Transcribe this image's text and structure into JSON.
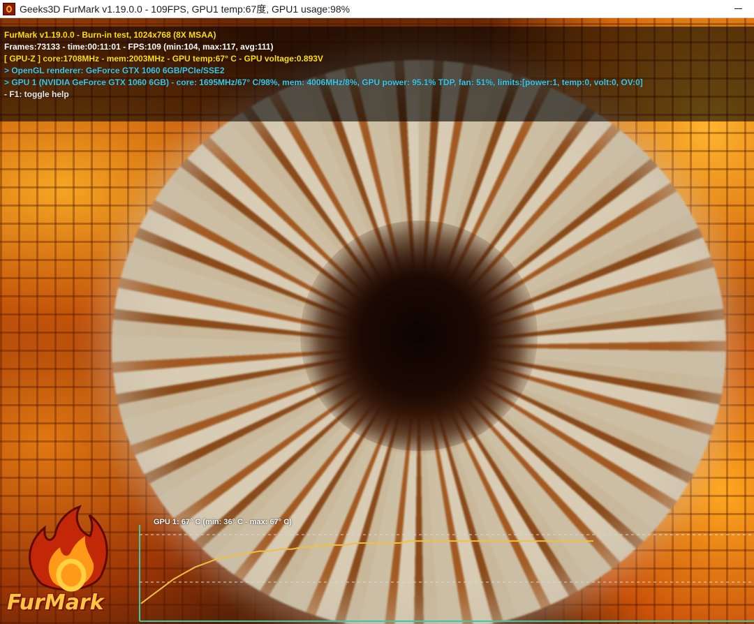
{
  "window": {
    "title": "Geeks3D FurMark v1.19.0.0 - 109FPS, GPU1 temp:67度, GPU1 usage:98%"
  },
  "icons": {
    "app": "furmark-app-icon",
    "minimize": "minimize-icon"
  },
  "hud": {
    "lines": [
      {
        "text": "FurMark v1.19.0.0 - Burn-in test, 1024x768 (8X MSAA)",
        "color": "#ffe000"
      },
      {
        "text": "Frames:73133 - time:00:11:01 - FPS:109 (min:104, max:117, avg:111)",
        "color": "#ffffff"
      },
      {
        "text": "[ GPU-Z ] core:1708MHz - mem:2003MHz - GPU temp:67° C - GPU voltage:0.893V",
        "color": "#ffe000"
      },
      {
        "text": "> OpenGL renderer: GeForce GTX 1060 6GB/PCIe/SSE2",
        "color": "#3ec8e8"
      },
      {
        "text": "> GPU 1 (NVIDIA GeForce GTX 1060 6GB) - core: 1695MHz/67° C/98%, mem: 4006MHz/8%, GPU power: 95.1% TDP, fan: 51%, limits:[power:1, temp:0, volt:0, OV:0]",
        "color": "#3ec8e8"
      },
      {
        "text": "- F1: toggle help",
        "color": "#e8e8e8"
      }
    ]
  },
  "graph": {
    "label": "GPU 1: 67° C (min: 36° C - max: 67° C)",
    "line_color": "#f0c040",
    "axis_color": "#3ec8a8",
    "grid_color": "#d8d8d8",
    "temps": [
      36,
      40,
      44,
      48,
      51,
      54,
      56,
      58,
      59,
      60,
      61,
      62,
      62,
      63,
      63,
      64,
      64,
      65,
      65,
      65,
      66,
      66,
      66,
      66,
      66,
      67,
      67,
      67,
      67,
      67,
      67,
      67,
      67,
      67,
      67,
      67,
      67,
      67,
      67,
      67,
      67,
      67,
      67
    ],
    "temp_min": 30,
    "temp_max": 75
  },
  "logo": {
    "text": "FurMark"
  }
}
